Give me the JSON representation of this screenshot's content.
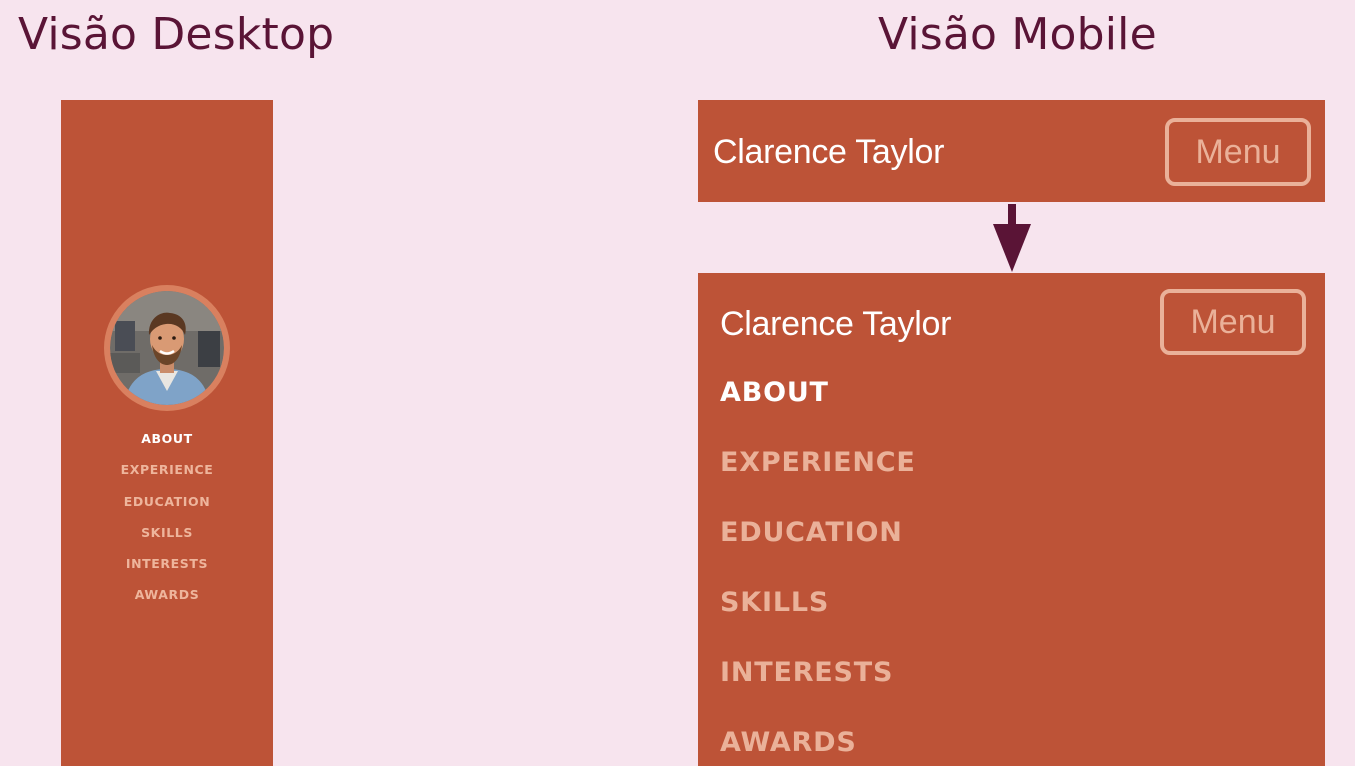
{
  "titles": {
    "desktop": "Visão Desktop",
    "mobile": "Visão Mobile"
  },
  "colors": {
    "background": "#f7e4ee",
    "title": "#5a1436",
    "nav_background": "#bd5337",
    "nav_active": "#ffffff",
    "nav_inactive": "#eab199",
    "arrow": "#5a1436"
  },
  "desktop_sidebar": {
    "avatar_alt": "profile-photo",
    "nav_items": [
      {
        "label": "ABOUT",
        "active": true
      },
      {
        "label": "EXPERIENCE",
        "active": false
      },
      {
        "label": "EDUCATION",
        "active": false
      },
      {
        "label": "SKILLS",
        "active": false
      },
      {
        "label": "INTERESTS",
        "active": false
      },
      {
        "label": "AWARDS",
        "active": false
      }
    ]
  },
  "mobile_collapsed": {
    "brand": "Clarence Taylor",
    "menu_button": "Menu"
  },
  "mobile_expanded": {
    "brand": "Clarence Taylor",
    "menu_button": "Menu",
    "nav_items": [
      {
        "label": "ABOUT",
        "active": true
      },
      {
        "label": "EXPERIENCE",
        "active": false
      },
      {
        "label": "EDUCATION",
        "active": false
      },
      {
        "label": "SKILLS",
        "active": false
      },
      {
        "label": "INTERESTS",
        "active": false
      },
      {
        "label": "AWARDS",
        "active": false
      }
    ]
  },
  "icons": {
    "transition_arrow": "arrow-down-icon"
  }
}
